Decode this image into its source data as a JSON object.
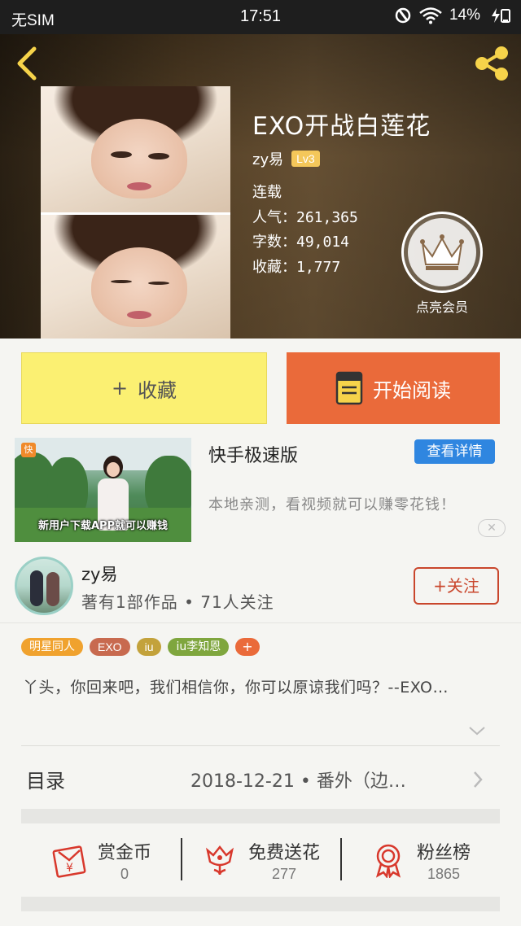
{
  "status_bar": {
    "carrier": "无SIM",
    "time": "17:51",
    "battery": "14%"
  },
  "book": {
    "title": "EXO开战白莲花",
    "author": "zy易",
    "level": "Lv3",
    "status": "连载",
    "popularity": "人气：261,365",
    "word_count": "字数：49,014",
    "favorites": "收藏：1,777",
    "vip_label": "点亮会员"
  },
  "actions": {
    "favorite_label": "收藏",
    "favorite_plus": "+",
    "read_label": "开始阅读"
  },
  "ad": {
    "thumb_logo": "快",
    "thumb_caption": "新用户下载APP就可以赚钱",
    "app_name": "快手极速版",
    "detail_button": "查看详情",
    "description": "本地亲测，看视频就可以赚零花钱！",
    "close": "✕"
  },
  "author_card": {
    "name": "zy易",
    "stats": "著有1部作品 • 71人关注",
    "follow_label": "+关注"
  },
  "tags": [
    "明星同人",
    "EXO",
    "iu",
    "iu李知恩",
    "+"
  ],
  "synopsis": "丫头，你回来吧，我们相信你，你可以原谅我们吗？--EXO…",
  "toc": {
    "label": "目录",
    "latest": "2018-12-21 • 番外（边…"
  },
  "stats": [
    {
      "label": "赏金币",
      "value": "0",
      "icon": "red-envelope-icon"
    },
    {
      "label": "免费送花",
      "value": "277",
      "icon": "flower-icon"
    },
    {
      "label": "粉丝榜",
      "value": "1865",
      "icon": "medal-icon"
    }
  ],
  "colors": {
    "read_button": "#ea6a3a",
    "favorite_button": "#fbf072",
    "accent_red": "#c9462c",
    "link_blue": "#2f86e0"
  }
}
